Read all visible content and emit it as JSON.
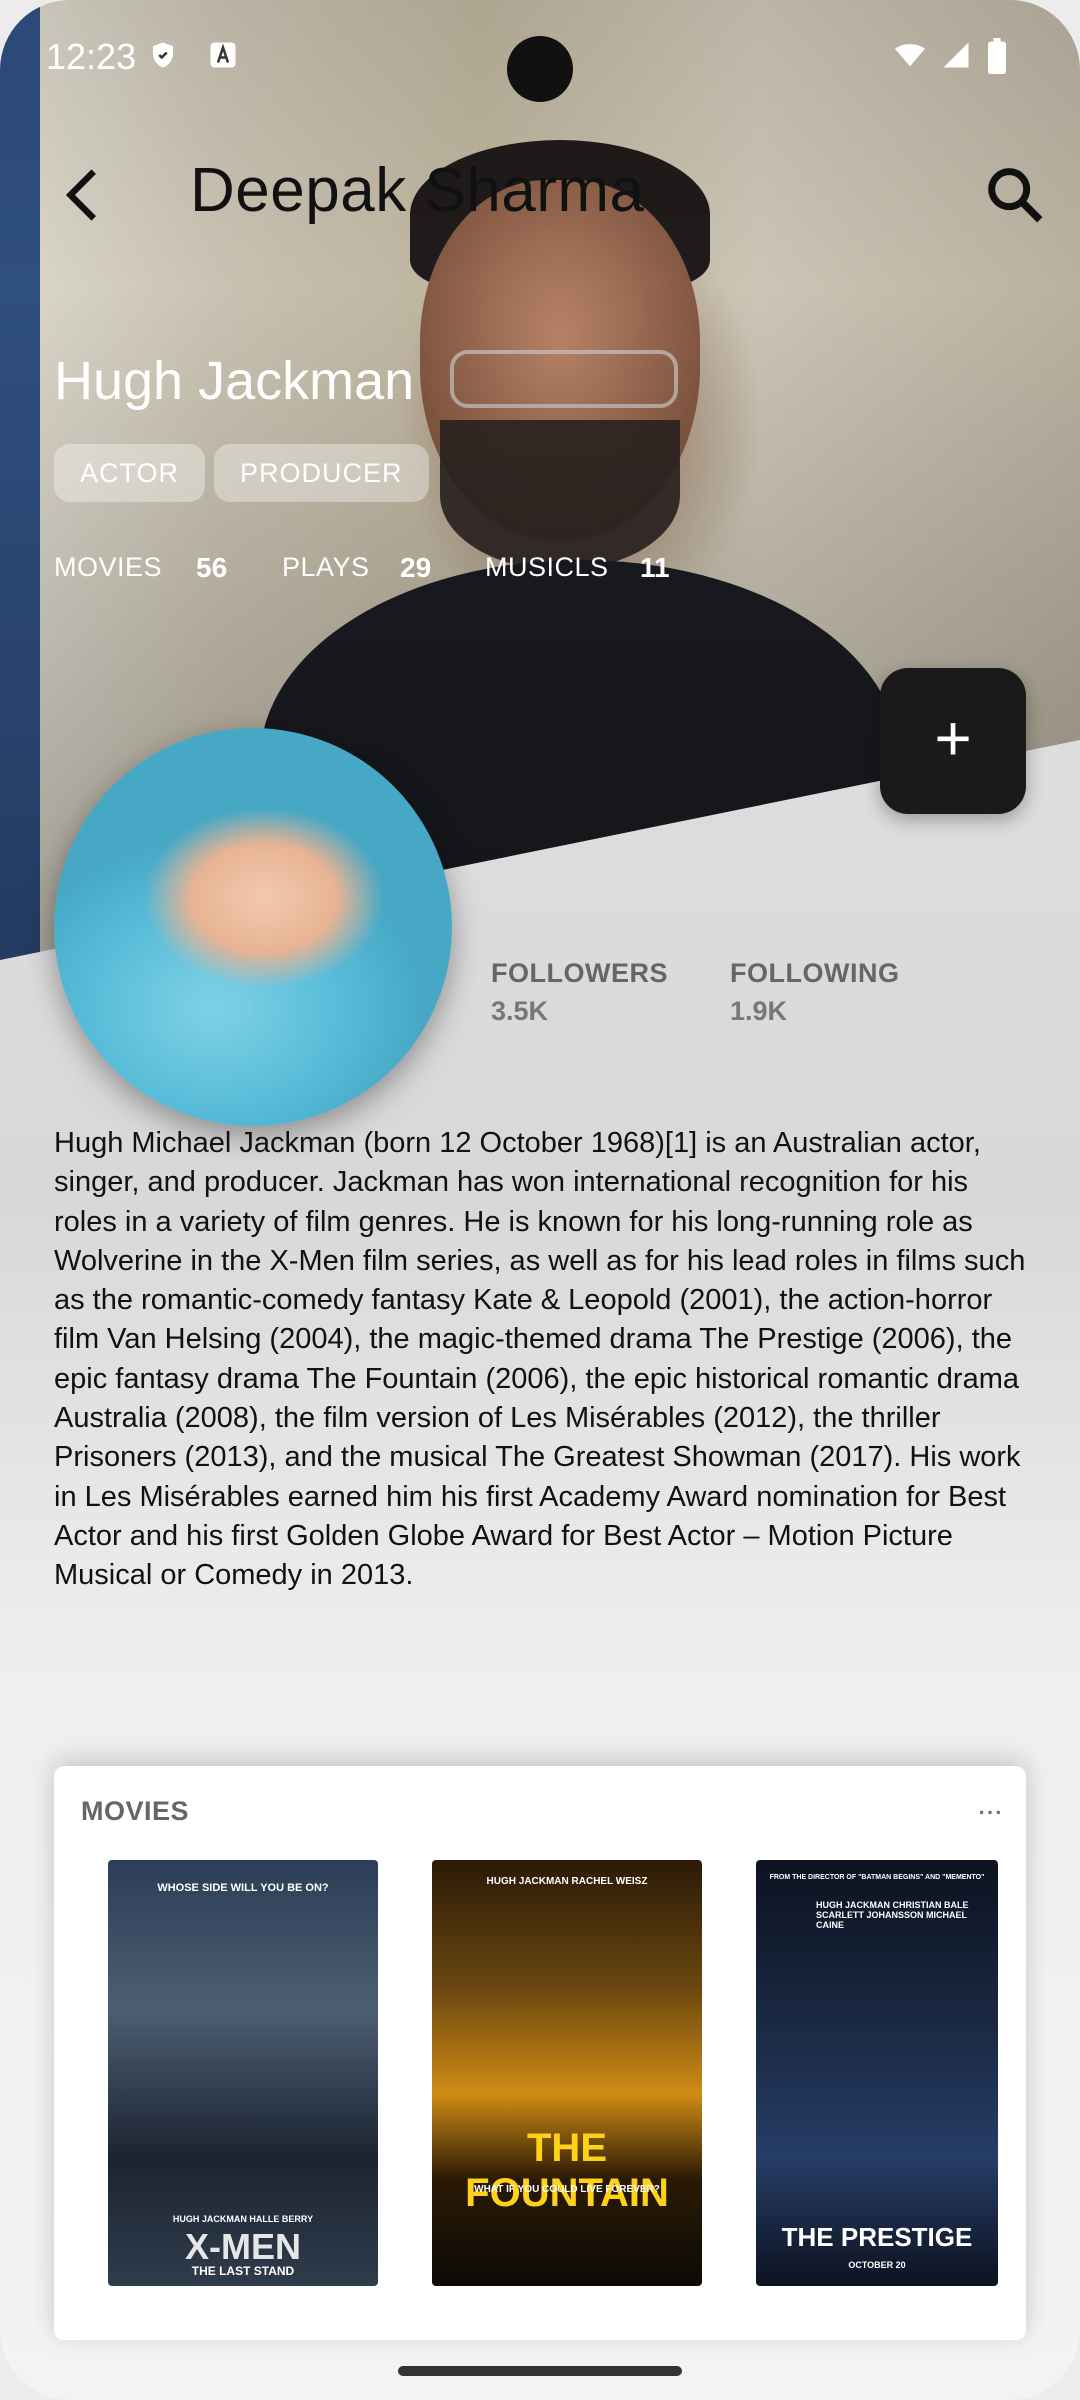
{
  "status_bar": {
    "time": "12:23"
  },
  "app_bar": {
    "title": "Deepak Sharma"
  },
  "profile": {
    "name": "Hugh Jackman",
    "roles": [
      "ACTOR",
      "PRODUCER"
    ],
    "stats": [
      {
        "label": "MOVIES",
        "value": "56"
      },
      {
        "label": "PLAYS",
        "value": "29"
      },
      {
        "label": "MUSICLS",
        "value": "11"
      }
    ],
    "followers": {
      "label": "FOLLOWERS",
      "value": "3.5K"
    },
    "following": {
      "label": "FOLLOWING",
      "value": "1.9K"
    },
    "bio": "Hugh Michael Jackman (born 12 October 1968)[1] is an Australian actor, singer, and producer. Jackman has won international recognition for his roles in a variety of film genres. He is known for his long-running role as Wolverine in the X-Men film series, as well as for his lead roles in films such as the romantic-comedy fantasy Kate & Leopold (2001), the action-horror film Van Helsing (2004), the magic-themed drama The Prestige (2006), the epic fantasy drama The Fountain (2006), the epic historical romantic drama Australia (2008), the film version of Les Misérables (2012), the thriller Prisoners (2013), and the musical The Greatest Showman (2017). His work in Les Misérables earned him his first Academy Award nomination for Best Actor and his first Golden Globe Award for Best Actor – Motion Picture Musical or Comedy in 2013."
  },
  "fab": {
    "label": "+"
  },
  "movies_card": {
    "title": "MOVIES",
    "more": "...",
    "posters": [
      {
        "tagline": "WHOSE SIDE WILL YOU BE ON?",
        "title": "X-MEN",
        "subtitle": "THE LAST STAND",
        "credits": "HUGH JACKMAN   HALLE BERRY"
      },
      {
        "tagline": "WHAT IF YOU COULD LIVE FOREVER?",
        "title": "THE FOUNTAIN",
        "credits": "HUGH JACKMAN   RACHEL WEISZ"
      },
      {
        "tagline": "FROM THE DIRECTOR OF \"BATMAN BEGINS\" AND \"MEMENTO\"",
        "title": "THE PRESTIGE",
        "subtitle": "OCTOBER 20",
        "credits": "HUGH JACKMAN  CHRISTIAN BALE  SCARLETT JOHANSSON  MICHAEL CAINE"
      }
    ]
  },
  "colors": {
    "fab": "#1a1a1a",
    "chip_bg": "rgba(255,255,255,0.35)",
    "label_gray": "#666666"
  }
}
